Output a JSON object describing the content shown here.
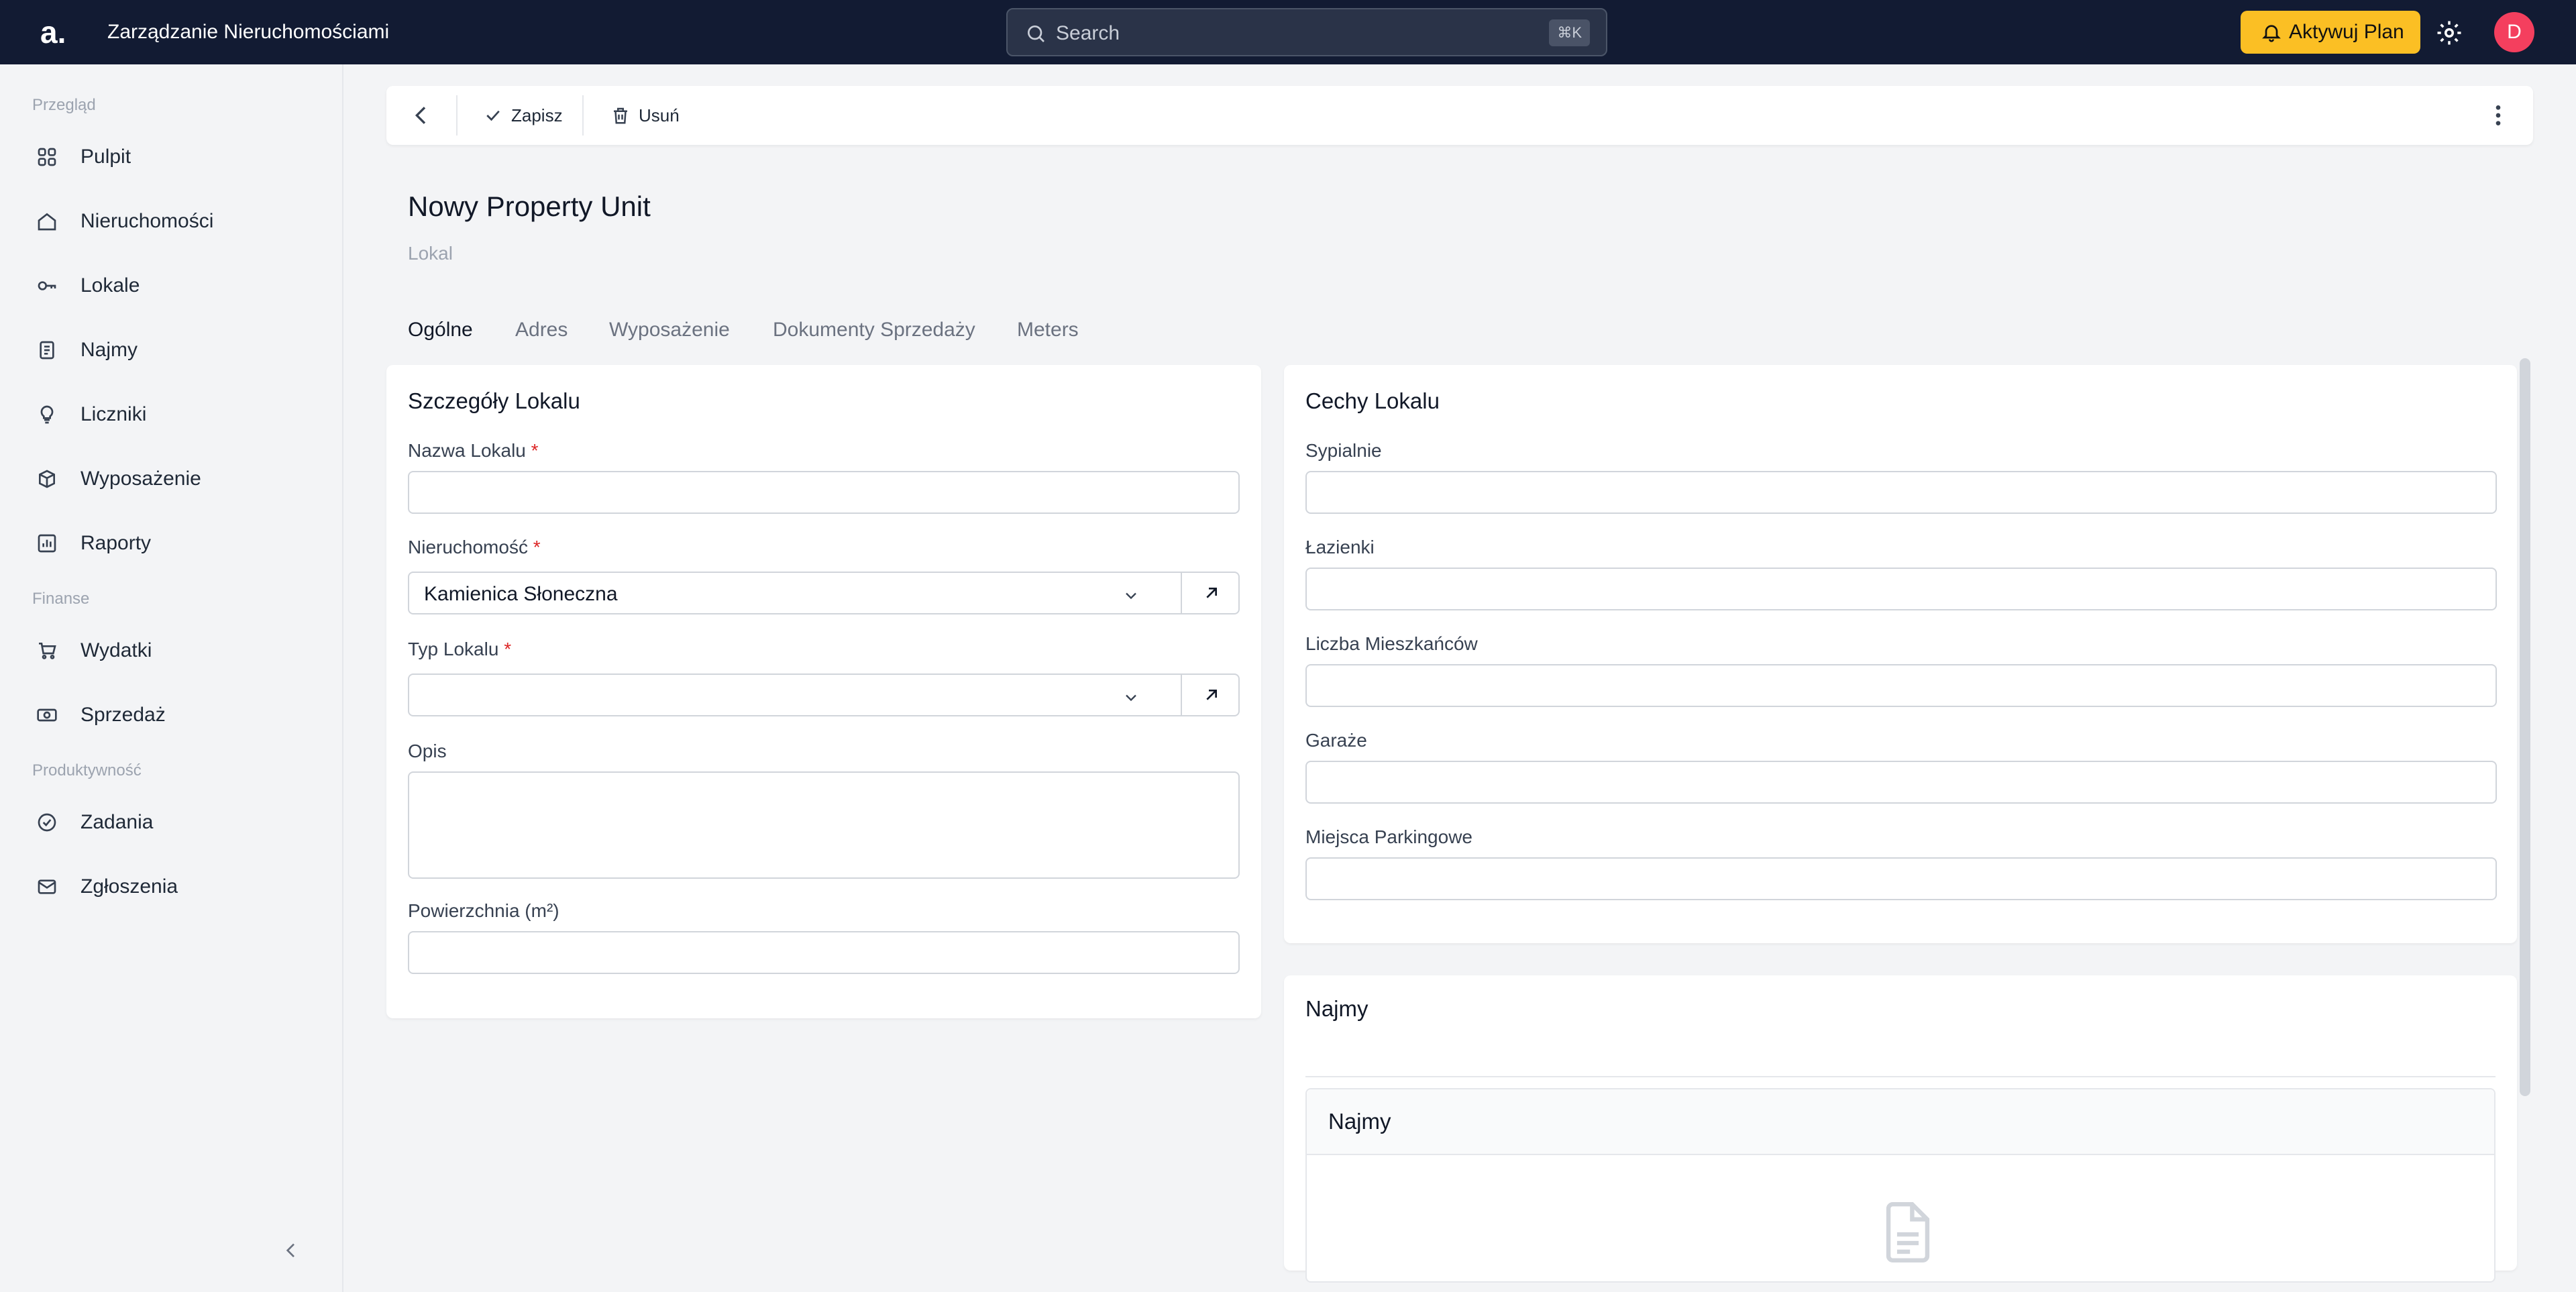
{
  "topbar": {
    "logo_text": "a.",
    "app_title": "Zarządzanie Nieruchomościami",
    "search_placeholder": "Search",
    "search_shortcut": "⌘K",
    "plan_button": "Aktywuj Plan",
    "avatar_initial": "D",
    "accent_color": "#fbbf24"
  },
  "sidebar": {
    "sections": [
      {
        "label": "Przegląd"
      },
      {
        "label": "Finanse"
      },
      {
        "label": "Produktywność"
      }
    ],
    "items": [
      {
        "label": "Pulpit",
        "icon": "dashboard-icon"
      },
      {
        "label": "Nieruchomości",
        "icon": "home-icon"
      },
      {
        "label": "Lokale",
        "icon": "key-icon"
      },
      {
        "label": "Najmy",
        "icon": "document-icon"
      },
      {
        "label": "Liczniki",
        "icon": "lightbulb-icon"
      },
      {
        "label": "Wyposażenie",
        "icon": "box-icon"
      },
      {
        "label": "Raporty",
        "icon": "chart-icon"
      },
      {
        "label": "Wydatki",
        "icon": "cart-icon"
      },
      {
        "label": "Sprzedaż",
        "icon": "cash-icon"
      },
      {
        "label": "Zadania",
        "icon": "check-circle-icon"
      },
      {
        "label": "Zgłoszenia",
        "icon": "mail-icon"
      }
    ]
  },
  "toolbar": {
    "save_label": "Zapisz",
    "delete_label": "Usuń"
  },
  "page": {
    "title": "Nowy Property Unit",
    "subtitle": "Lokal"
  },
  "tabs": [
    {
      "label": "Ogólne",
      "active": true
    },
    {
      "label": "Adres",
      "active": false
    },
    {
      "label": "Wyposażenie",
      "active": false
    },
    {
      "label": "Dokumenty Sprzedaży",
      "active": false
    },
    {
      "label": "Meters",
      "active": false
    }
  ],
  "details_card": {
    "title": "Szczegóły Lokalu",
    "fields": {
      "name_label": "Nazwa Lokalu",
      "name_value": "",
      "property_label": "Nieruchomość",
      "property_value": "Kamienica Słoneczna",
      "type_label": "Typ Lokalu",
      "type_value": "",
      "description_label": "Opis",
      "description_value": "",
      "area_label": "Powierzchnia (m²)",
      "area_value": ""
    },
    "required_mark": "*"
  },
  "features_card": {
    "title": "Cechy Lokalu",
    "fields": [
      {
        "label": "Sypialnie",
        "value": ""
      },
      {
        "label": "Łazienki",
        "value": ""
      },
      {
        "label": "Liczba Mieszkańców",
        "value": ""
      },
      {
        "label": "Garaże",
        "value": ""
      },
      {
        "label": "Miejsca Parkingowe",
        "value": ""
      }
    ]
  },
  "leases_card": {
    "title": "Najmy",
    "panel_title": "Najmy"
  }
}
